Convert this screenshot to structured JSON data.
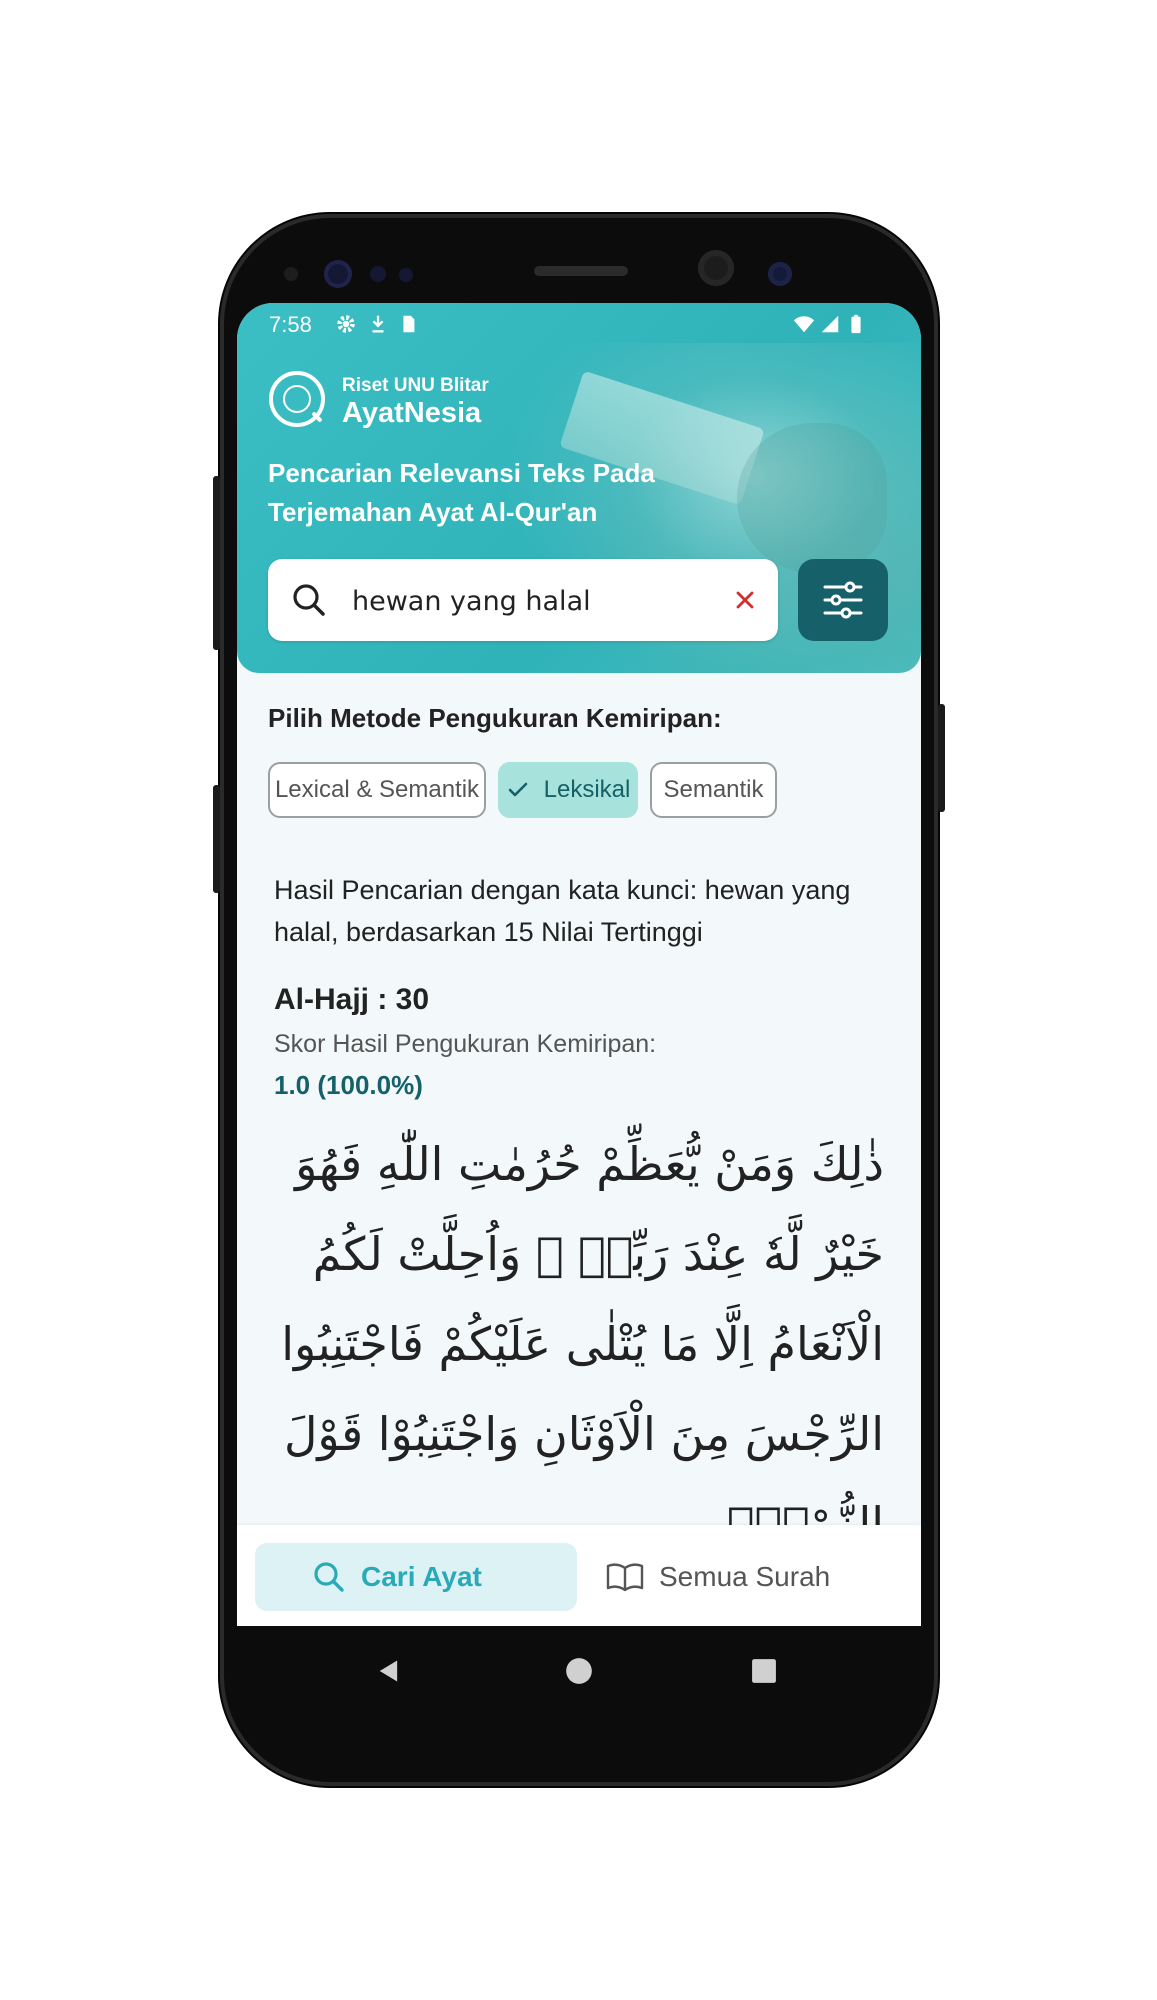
{
  "status_bar": {
    "time": "7:58"
  },
  "header": {
    "brand_sub": "Riset UNU Blitar",
    "brand_name": "AyatNesia",
    "tagline": "Pencarian Relevansi Teks Pada Terjemahan Ayat Al-Qur'an"
  },
  "search": {
    "value": "hewan yang halal"
  },
  "method": {
    "title": "Pilih Metode Pengukuran Kemiripan:",
    "options": [
      {
        "label": "Lexical & Semantik",
        "selected": false
      },
      {
        "label": "Leksikal",
        "selected": true
      },
      {
        "label": "Semantik",
        "selected": false
      }
    ]
  },
  "results": {
    "intro": "Hasil Pencarian dengan kata kunci: hewan yang halal, berdasarkan 15 Nilai Tertinggi",
    "items": [
      {
        "reference": "Al-Hajj : 30",
        "score_label": "Skor Hasil Pengukuran Kemiripan:",
        "score_value": "1.0 (100.0%)",
        "arabic": "ذٰلِكَ وَمَنْ يُّعَظِّمْ حُرُمٰتِ اللّٰهِ فَهُوَ خَيْرٌ لَّهٗ عِنْدَ رَبِّهٖ ۗ وَاُحِلَّتْ لَكُمُ الْاَنْعَامُ اِلَّا مَا يُتْلٰى عَلَيْكُمْ فَاجْتَنِبُوا الرِّجْسَ مِنَ الْاَوْثَانِ وَاجْتَنِبُوْا قَوْلَ الزُّوْرِۙ"
      }
    ]
  },
  "bottom_nav": {
    "items": [
      {
        "label": "Cari Ayat",
        "active": true
      },
      {
        "label": "Semua Surah",
        "active": false
      }
    ]
  },
  "colors": {
    "header_teal": "#35b8be",
    "primary_dark": "#16606a",
    "chip_active": "#a7e3dc",
    "nav_active_bg": "#dcf2f4",
    "nav_active_text": "#2aa9b8"
  }
}
